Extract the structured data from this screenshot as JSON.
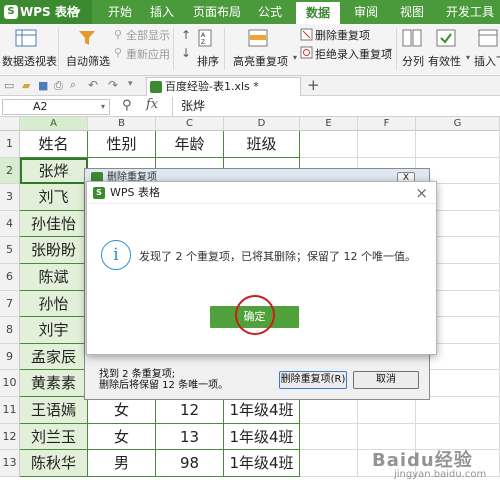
{
  "menubar": {
    "app_name": "WPS 表格",
    "tabs": [
      "开始",
      "插入",
      "页面布局",
      "公式",
      "数据",
      "审阅",
      "视图",
      "开发工具"
    ],
    "active_tab": "数据",
    "accent_color": "#4a9a3c"
  },
  "ribbon": {
    "pivot": "数据透视表",
    "autofilter": "自动筛选",
    "show_all": "全部显示",
    "reapply": "重新应用",
    "sort": "排序",
    "highlight_dup": "高亮重复项",
    "remove_dup": "删除重复项",
    "reject_dup": "拒绝录入重复项",
    "split": "分列",
    "validity": "有效性",
    "insert_dropdown": "插入下"
  },
  "toolbar": {
    "doc_tab": "百度经验-表1.xls *",
    "new_tab": "+"
  },
  "formula_bar": {
    "cell_ref": "A2",
    "fx": "fx",
    "value": "张烨"
  },
  "grid": {
    "columns": [
      "A",
      "B",
      "C",
      "D",
      "E",
      "F",
      "G"
    ],
    "rows": [
      "1",
      "2",
      "3",
      "4",
      "5",
      "6",
      "7",
      "8",
      "9",
      "10",
      "11",
      "12",
      "13"
    ],
    "header": [
      "姓名",
      "性别",
      "年龄",
      "班级"
    ],
    "names": [
      "张烨",
      "刘飞",
      "孙佳怡",
      "张盼盼",
      "陈斌",
      "孙怡",
      "刘宇",
      "孟家辰",
      "黄素素",
      "王语嫣",
      "刘兰玉",
      "陈秋华"
    ],
    "data_rows": [
      [
        "王语嫣",
        "女",
        "12",
        "1年级4班"
      ],
      [
        "刘兰玉",
        "女",
        "13",
        "1年级4班"
      ],
      [
        "陈秋华",
        "男",
        "98",
        "1年级4班"
      ]
    ]
  },
  "bg_dialog": {
    "title": "删除重复项",
    "close": "X",
    "status_line1": "找到 2 条重复项;",
    "status_line2": "删除后将保留 12 条唯一项。",
    "remove_button": "删除重复项(R)",
    "cancel_button": "取消"
  },
  "msgbox": {
    "title": "WPS 表格",
    "message": "发现了 2 个重复项，已将其删除；保留了 12 个唯一值。",
    "ok_button": "确定",
    "close": "×",
    "ok_color": "#50a03c"
  },
  "watermark": {
    "logo": "Baidu经验",
    "url": "jingyan.baidu.com"
  }
}
